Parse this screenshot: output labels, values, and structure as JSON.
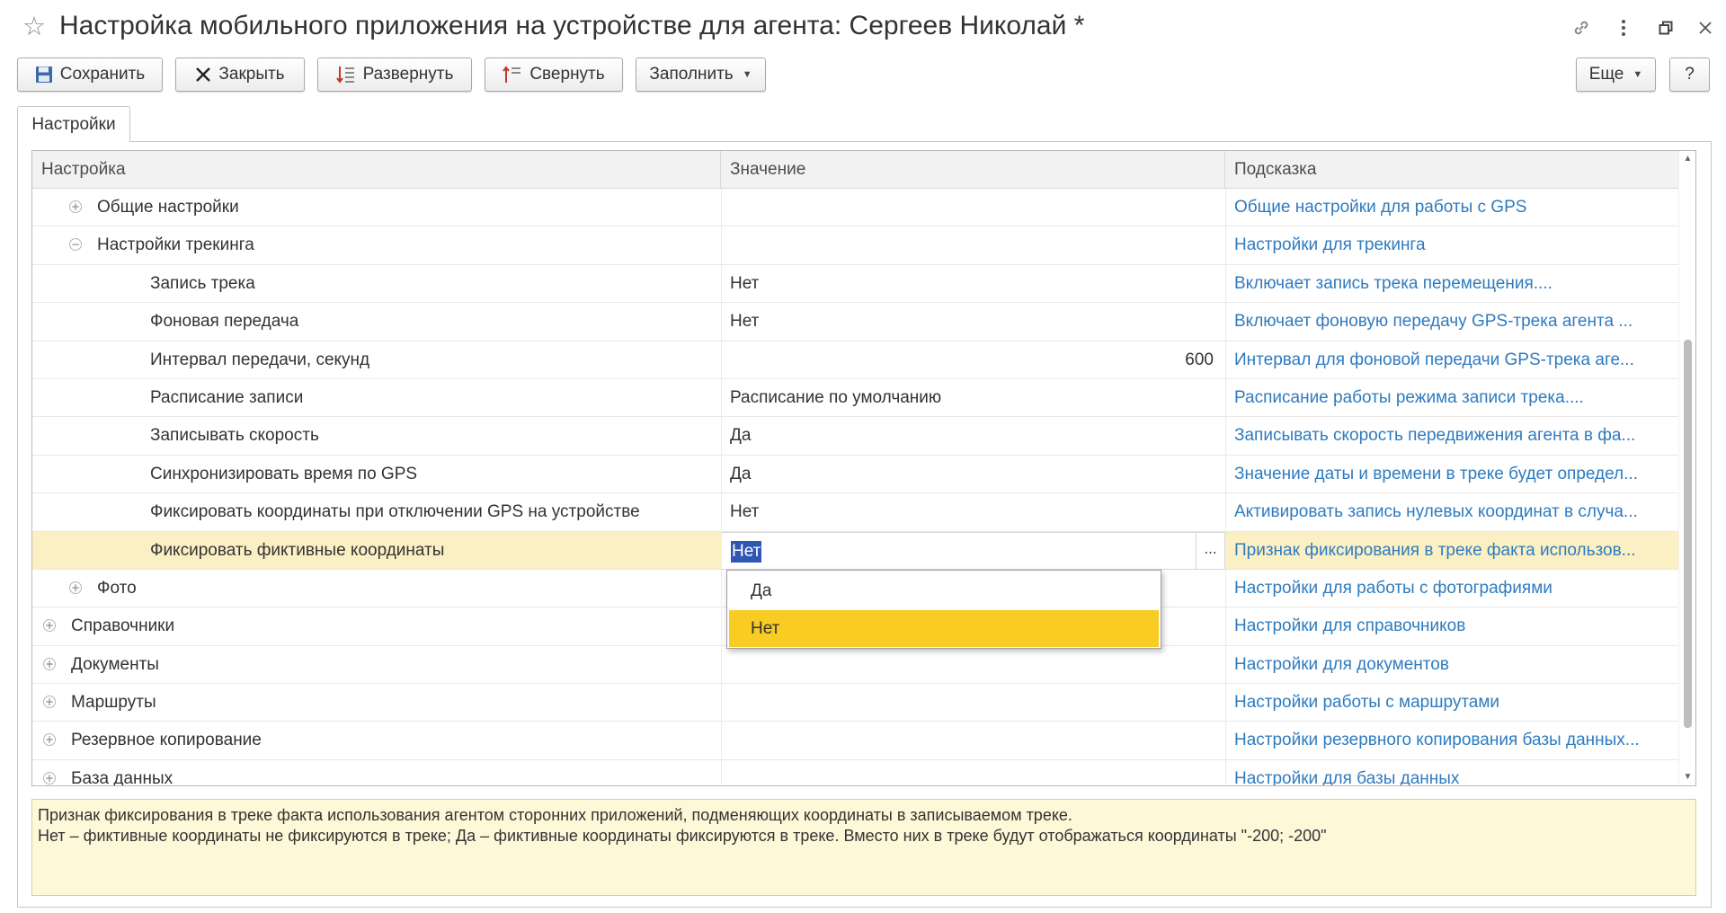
{
  "window": {
    "title": "Настройка мобильного приложения на устройстве для агента: Сергеев Николай *"
  },
  "toolbar": {
    "save": "Сохранить",
    "close": "Закрыть",
    "expand": "Развернуть",
    "collapse": "Свернуть",
    "fill": "Заполнить",
    "more": "Еще",
    "help": "?"
  },
  "tabs": [
    {
      "label": "Настройки",
      "active": true
    }
  ],
  "table": {
    "columns": [
      "Настройка",
      "Значение",
      "Подсказка"
    ],
    "rows": [
      {
        "name": "Общие настройки",
        "value": "",
        "hint": "Общие настройки для работы с GPS",
        "level": 1,
        "toggle": "expand"
      },
      {
        "name": "Настройки трекинга",
        "value": "",
        "hint": "Настройки для трекинга",
        "level": 1,
        "toggle": "collapse"
      },
      {
        "name": "Запись трека",
        "value": "Нет",
        "hint": "Включает запись трека перемещения....",
        "level": 2
      },
      {
        "name": "Фоновая передача",
        "value": "Нет",
        "hint": "Включает фоновую передачу GPS-трека агента ...",
        "level": 2
      },
      {
        "name": "Интервал передачи, секунд",
        "value": "600",
        "hint": "Интервал для фоновой передачи GPS-трека аге...",
        "level": 2,
        "numeric": true
      },
      {
        "name": "Расписание записи",
        "value": "Расписание по умолчанию",
        "hint": "Расписание работы режима записи трека....",
        "level": 2
      },
      {
        "name": "Записывать скорость",
        "value": "Да",
        "hint": "Записывать скорость передвижения агента в фа...",
        "level": 2
      },
      {
        "name": "Синхронизировать время по GPS",
        "value": "Да",
        "hint": "Значение даты и времени в треке будет определ...",
        "level": 2
      },
      {
        "name": "Фиксировать координаты при отключении GPS на устройстве",
        "value": "Нет",
        "hint": "Активировать запись нулевых координат в случа...",
        "level": 2
      },
      {
        "name": "Фиксировать фиктивные координаты",
        "value": "Нет",
        "hint": "Признак фиксирования в треке факта использов...",
        "level": 2,
        "selected": true,
        "editing": true
      },
      {
        "name": "Фото",
        "value": "",
        "hint": "Настройки для работы с фотографиями",
        "level": 1,
        "toggle": "expand"
      },
      {
        "name": "Справочники",
        "value": "",
        "hint": "Настройки для справочников",
        "level": 0,
        "toggle": "expand"
      },
      {
        "name": "Документы",
        "value": "",
        "hint": "Настройки для документов",
        "level": 0,
        "toggle": "expand"
      },
      {
        "name": "Маршруты",
        "value": "",
        "hint": "Настройки работы с маршрутами",
        "level": 0,
        "toggle": "expand"
      },
      {
        "name": "Резервное копирование",
        "value": "",
        "hint": "Настройки резервного копирования базы данных...",
        "level": 0,
        "toggle": "expand"
      },
      {
        "name": "База данных",
        "value": "",
        "hint": "Настройки для базы данных",
        "level": 0,
        "toggle": "expand"
      }
    ]
  },
  "editor": {
    "choice_button": "...",
    "options": [
      "Да",
      "Нет"
    ],
    "highlighted": "Нет"
  },
  "description": {
    "line1": "Признак фиксирования в треке факта использования агентом сторонних приложений, подменяющих координаты в записываемом треке.",
    "line2": "Нет – фиктивные координаты не фиксируются в треке; Да – фиктивные координаты фиксируются в треке. Вместо них в треке будут отображаться координаты \"-200; -200\""
  },
  "colors": {
    "hint_link": "#2f7bbf",
    "selected_row": "#fbf0c4",
    "dropdown_active": "#f8cc22",
    "text_selection": "#2f56b3",
    "description_bg": "#fdf8d8"
  }
}
